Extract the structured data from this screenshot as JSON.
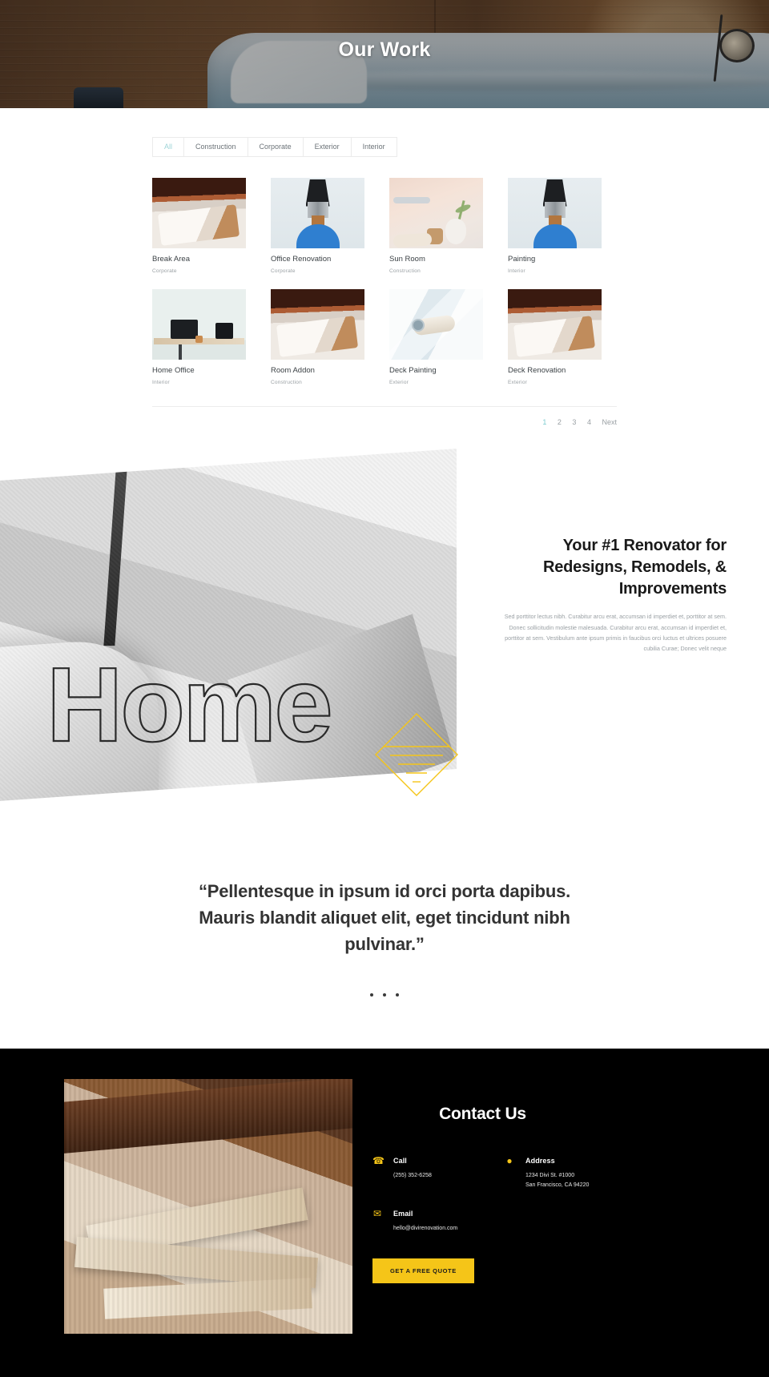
{
  "hero": {
    "title": "Our Work"
  },
  "gallery": {
    "filters": [
      {
        "label": "All",
        "active": true
      },
      {
        "label": "Construction",
        "active": false
      },
      {
        "label": "Corporate",
        "active": false
      },
      {
        "label": "Exterior",
        "active": false
      },
      {
        "label": "Interior",
        "active": false
      }
    ],
    "items": [
      {
        "title": "Break Area",
        "category": "Corporate"
      },
      {
        "title": "Office Renovation",
        "category": "Corporate"
      },
      {
        "title": "Sun Room",
        "category": "Construction"
      },
      {
        "title": "Painting",
        "category": "Interior"
      },
      {
        "title": "Home Office",
        "category": "Interior"
      },
      {
        "title": "Room Addon",
        "category": "Construction"
      },
      {
        "title": "Deck Painting",
        "category": "Exterior"
      },
      {
        "title": "Deck Renovation",
        "category": "Exterior"
      }
    ],
    "pagination": {
      "pages": [
        "1",
        "2",
        "3",
        "4"
      ],
      "current": "1",
      "next_label": "Next"
    }
  },
  "about": {
    "heading": "Your #1 Renovator for Redesigns, Remodels, & Improvements",
    "paragraph": "Sed porttitor lectus nibh. Curabitur arcu erat, accumsan id imperdiet et, porttitor at sem. Donec sollicitudin molestie malesuada. Curabitur arcu erat, accumsan id imperdiet et, porttitor at sem. Vestibulum ante ipsum primis in faucibus orci luctus et ultrices posuere cubilia Curae; Donec velit neque",
    "wordmark": "Home"
  },
  "testimonial": {
    "quote": "“Pellentesque in ipsum id orci porta dapibus. Mauris blandit aliquet elit, eget tincidunt nibh pulvinar.”",
    "slide_count": 3
  },
  "footer": {
    "title": "Contact Us",
    "items": [
      {
        "icon": "phone-icon",
        "label": "Call",
        "value": "(255) 352-6258"
      },
      {
        "icon": "map-pin-icon",
        "label": "Address",
        "value": "1234 Divi St. #1000\nSan Francisco, CA 94220"
      },
      {
        "icon": "envelope-icon",
        "label": "Email",
        "value": "hello@divirenovation.com"
      }
    ],
    "cta_label": "GET A FREE QUOTE"
  },
  "colors": {
    "accent_yellow": "#f5c518",
    "accent_teal": "#7ecbcf",
    "dark": "#000000"
  }
}
